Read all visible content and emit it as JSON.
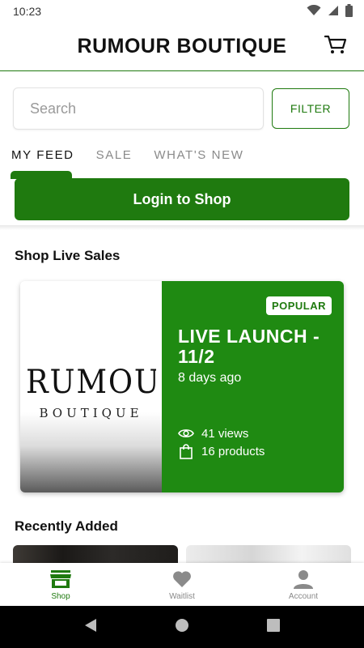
{
  "status_bar": {
    "time": "10:23"
  },
  "header": {
    "title": "RUMOUR BOUTIQUE",
    "cart_icon": "cart-icon"
  },
  "search": {
    "placeholder": "Search",
    "value": ""
  },
  "filter": {
    "label": "FILTER"
  },
  "tabs": [
    {
      "label": "MY FEED",
      "active": true
    },
    {
      "label": "SALE",
      "active": false
    },
    {
      "label": "WHAT'S NEW",
      "active": false
    }
  ],
  "login": {
    "label": "Login to Shop"
  },
  "live_sales": {
    "section_title": "Shop Live Sales",
    "card": {
      "logo_text": "RUMOUR",
      "logo_sub": "BOUTIQUE",
      "badge": "POPULAR",
      "title": "LIVE LAUNCH - 11/2",
      "time_ago": "8 days ago",
      "views": "41 views",
      "products": "16 products"
    }
  },
  "recently_added": {
    "section_title": "Recently Added"
  },
  "bottom_nav": [
    {
      "label": "Shop",
      "icon": "store-icon",
      "active": true
    },
    {
      "label": "Waitlist",
      "icon": "heart-icon",
      "active": false
    },
    {
      "label": "Account",
      "icon": "person-icon",
      "active": false
    }
  ],
  "colors": {
    "brand_green": "#1f7a0f",
    "card_green": "#1f8a12"
  }
}
